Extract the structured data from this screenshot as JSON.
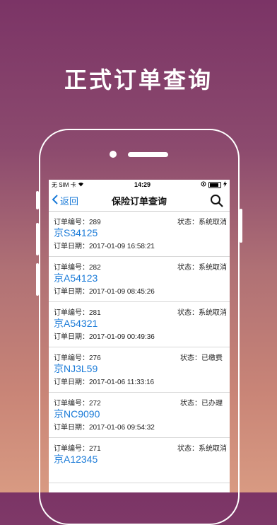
{
  "headline": "正式订单查询",
  "status_bar": {
    "carrier": "无 SIM 卡",
    "time": "14:29"
  },
  "nav": {
    "back_label": "返回",
    "title": "保险订单查询"
  },
  "labels": {
    "order_no": "订单编号：",
    "order_date": "订单日期：",
    "status": "状态："
  },
  "orders": [
    {
      "number": "289",
      "plate": "京S34125",
      "date": "2017-01-09 16:58:21",
      "status": "系统取消"
    },
    {
      "number": "282",
      "plate": "京A54123",
      "date": "2017-01-09 08:45:26",
      "status": "系统取消"
    },
    {
      "number": "281",
      "plate": "京A54321",
      "date": "2017-01-09 00:49:36",
      "status": "系统取消"
    },
    {
      "number": "276",
      "plate": "京NJ3L59",
      "date": "2017-01-06 11:33:16",
      "status": "已缴费"
    },
    {
      "number": "272",
      "plate": "京NC9090",
      "date": "2017-01-06 09:54:32",
      "status": "已办理"
    },
    {
      "number": "271",
      "plate": "京A12345",
      "date": "",
      "status": "系统取消"
    }
  ]
}
